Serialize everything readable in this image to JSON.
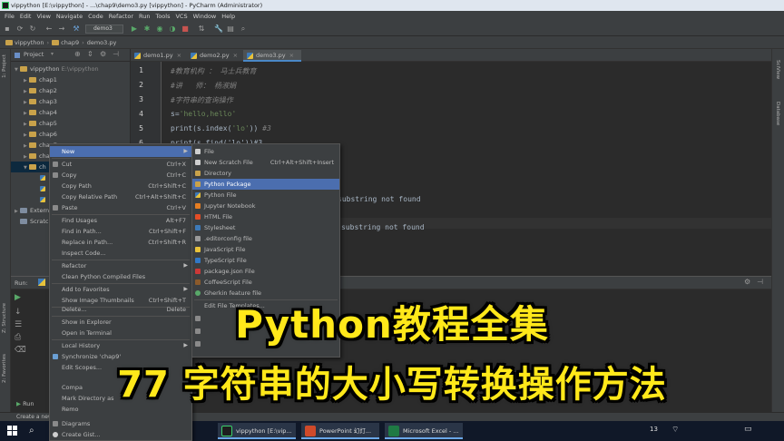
{
  "window": {
    "title": "vippython [E:\\vippython] - ...\\chap9\\demo3.py [vippython] - PyCharm (Administrator)"
  },
  "menubar": [
    "File",
    "Edit",
    "View",
    "Navigate",
    "Code",
    "Refactor",
    "Run",
    "Tools",
    "VCS",
    "Window",
    "Help"
  ],
  "toolbar": {
    "run_config": "demo3"
  },
  "breadcrumb": [
    "vippython",
    "chap9",
    "demo3.py"
  ],
  "project_panel": {
    "header": "Project",
    "tree": [
      {
        "label": "vippython",
        "note": "E:\\vippython",
        "level": 0,
        "open": true
      },
      {
        "label": "chap1",
        "level": 1
      },
      {
        "label": "chap2",
        "level": 1
      },
      {
        "label": "chap3",
        "level": 1
      },
      {
        "label": "chap4",
        "level": 1
      },
      {
        "label": "chap5",
        "level": 1
      },
      {
        "label": "chap6",
        "level": 1
      },
      {
        "label": "chap7",
        "level": 1
      },
      {
        "label": "cha",
        "level": 1
      },
      {
        "label": "ch",
        "level": 1,
        "open": true,
        "selected": true
      }
    ],
    "extra": [
      "Extern",
      "Scratc"
    ]
  },
  "tool_windows": {
    "left": [
      "1: Project",
      "Z: Structure",
      "2: Favorites"
    ],
    "right": [
      "SciView",
      "Database"
    ]
  },
  "editor": {
    "tabs": [
      {
        "label": "demo1.py",
        "active": false
      },
      {
        "label": "demo2.py",
        "active": false
      },
      {
        "label": "demo3.py",
        "active": true
      }
    ],
    "line_numbers": [
      "1",
      "2",
      "3",
      "4",
      "5",
      "6"
    ],
    "lines": {
      "l1": "#教育机构 ： 马士兵教育",
      "l2": "#讲   师： 杨淑娟",
      "l3": "#字符串的查询操作",
      "l4a": "s=",
      "l4b": "'hello,hello'",
      "l5a": "print(s.index(",
      "l5b": "'lo'",
      "l5c": ")) ",
      "l5d": "#3",
      "l6": "print(s.find('lo'))#3"
    },
    "output_fragments": [
      "substring not found",
      "substring not found"
    ]
  },
  "run_panel": {
    "label": "Run:",
    "tab": "Run"
  },
  "context_menu": {
    "items": [
      {
        "label": "New",
        "shortcut": "",
        "submenu": true,
        "highlight": true
      },
      {
        "label": "Cut",
        "shortcut": "Ctrl+X"
      },
      {
        "label": "Copy",
        "shortcut": "Ctrl+C"
      },
      {
        "label": "Copy Path",
        "shortcut": "Ctrl+Shift+C"
      },
      {
        "label": "Copy Relative Path",
        "shortcut": "Ctrl+Alt+Shift+C"
      },
      {
        "label": "Paste",
        "shortcut": "Ctrl+V"
      },
      {
        "label": "Find Usages",
        "shortcut": "Alt+F7"
      },
      {
        "label": "Find in Path...",
        "shortcut": "Ctrl+Shift+F"
      },
      {
        "label": "Replace in Path...",
        "shortcut": "Ctrl+Shift+R"
      },
      {
        "label": "Inspect Code...",
        "shortcut": ""
      },
      {
        "label": "Refactor",
        "shortcut": "",
        "submenu": true
      },
      {
        "label": "Clean Python Compiled Files",
        "shortcut": ""
      },
      {
        "label": "Add to Favorites",
        "shortcut": "",
        "submenu": true
      },
      {
        "label": "Show Image Thumbnails",
        "shortcut": "Ctrl+Shift+T"
      },
      {
        "label": "Delete...",
        "shortcut": "Delete"
      },
      {
        "label": "Show in Explorer",
        "shortcut": ""
      },
      {
        "label": "Open in Terminal",
        "shortcut": ""
      },
      {
        "label": "Local History",
        "shortcut": "",
        "submenu": true
      },
      {
        "label": "Synchronize 'chap9'",
        "shortcut": ""
      },
      {
        "label": "Edit Scopes...",
        "shortcut": ""
      },
      {
        "label": "Compa",
        "shortcut": ""
      },
      {
        "label": "Mark Directory as",
        "shortcut": ""
      },
      {
        "label": "Remo",
        "shortcut": ""
      },
      {
        "label": "Diagrams",
        "shortcut": ""
      },
      {
        "label": "Create Gist...",
        "shortcut": ""
      }
    ]
  },
  "new_submenu": {
    "items": [
      {
        "label": "File",
        "shortcut": ""
      },
      {
        "label": "New Scratch File",
        "shortcut": "Ctrl+Alt+Shift+Insert"
      },
      {
        "label": "Directory",
        "shortcut": ""
      },
      {
        "label": "Python Package",
        "shortcut": "",
        "highlight": true
      },
      {
        "label": "Python File",
        "shortcut": ""
      },
      {
        "label": "Jupyter Notebook",
        "shortcut": ""
      },
      {
        "label": "HTML File",
        "shortcut": ""
      },
      {
        "label": "Stylesheet",
        "shortcut": ""
      },
      {
        "label": ".editorconfig file",
        "shortcut": ""
      },
      {
        "label": "JavaScript File",
        "shortcut": ""
      },
      {
        "label": "TypeScript File",
        "shortcut": ""
      },
      {
        "label": "package.json File",
        "shortcut": ""
      },
      {
        "label": "CoffeeScript File",
        "shortcut": ""
      },
      {
        "label": "Gherkin feature file",
        "shortcut": ""
      },
      {
        "label": "Edit File Templates...",
        "shortcut": ""
      }
    ]
  },
  "overlay": {
    "line1": "Python教程全集",
    "line2": "77 字符串的大小写转换操作方法"
  },
  "statusbar": {
    "text": "Create a new"
  },
  "taskbar": {
    "apps": [
      {
        "label": "vippython [E:\\vip...",
        "color": "#1e1e1e"
      },
      {
        "label": "PowerPoint 幻灯...",
        "color": "#d04a2a"
      },
      {
        "label": "Microsoft Excel - ...",
        "color": "#1f7a44"
      }
    ],
    "clock_fragment": "13"
  }
}
